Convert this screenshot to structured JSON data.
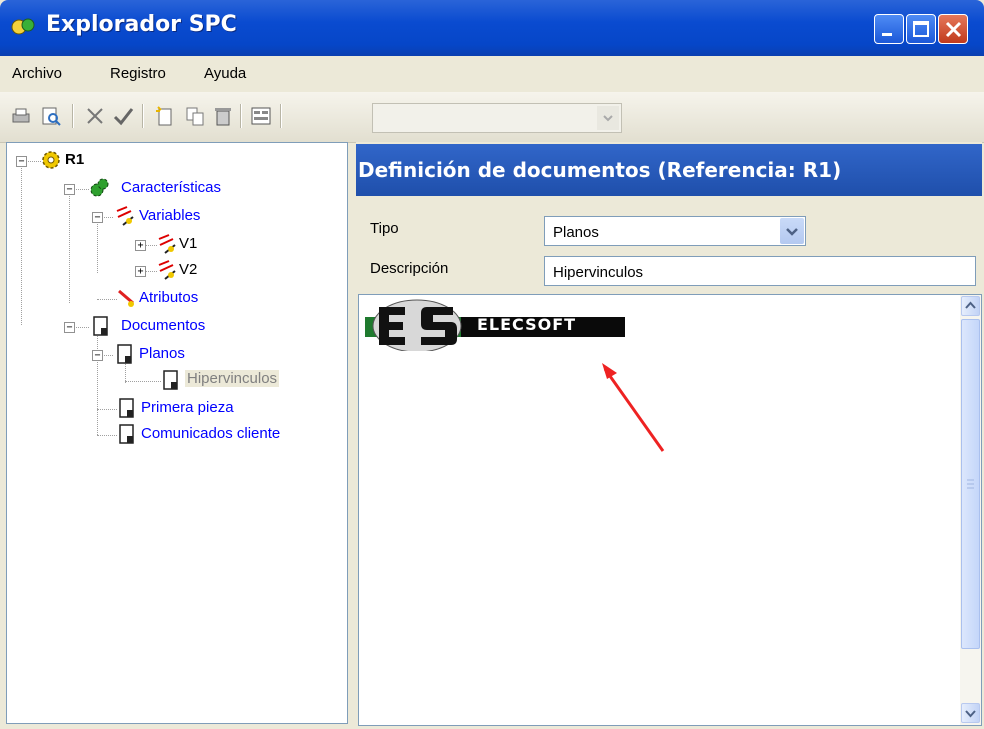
{
  "window": {
    "title": "Explorador SPC"
  },
  "menu": [
    {
      "label": "Archivo"
    },
    {
      "label": "Registro"
    },
    {
      "label": "Ayuda"
    }
  ],
  "toolbar": {
    "icons": [
      "print-icon",
      "print-preview-icon",
      "delete-x-icon",
      "accept-check-icon",
      "new-document-icon",
      "copy-icon",
      "trash-icon",
      "form-view-icon"
    ],
    "combo_value": ""
  },
  "tree": {
    "root": "R1",
    "caracteristicas": "Características",
    "variables": "Variables",
    "v1": "V1",
    "v2": "V2",
    "atributos": "Atributos",
    "documentos": "Documentos",
    "planos": "Planos",
    "hipervinculos": "Hipervinculos",
    "primera_pieza": "Primera pieza",
    "comunicados": "Comunicados cliente"
  },
  "detail": {
    "header": "Definición de documentos (Referencia: R1)",
    "tipo_label": "Tipo",
    "tipo_value": "Planos",
    "descripcion_label": "Descripción",
    "descripcion_value": "Hipervinculos",
    "logo_text": "ELECSOFT"
  },
  "colors": {
    "titlebar": "#0a4bd0",
    "header": "#2a5cb8",
    "link": "#0000ff",
    "arrow": "#ee2222"
  }
}
